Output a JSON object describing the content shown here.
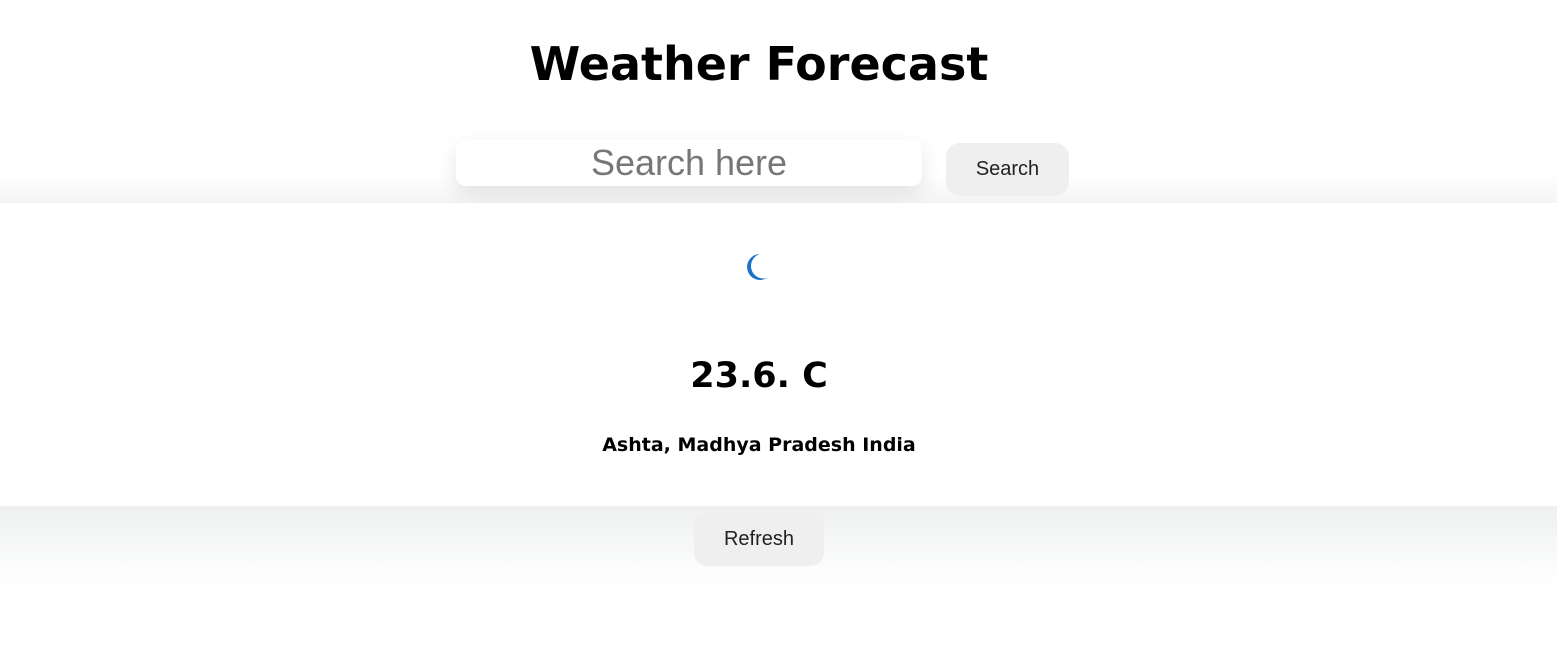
{
  "header": {
    "title": "Weather Forecast"
  },
  "search": {
    "placeholder": "Search here",
    "value": "",
    "button_label": "Search"
  },
  "weather": {
    "icon": "moon-icon",
    "icon_color": "#1a73c8",
    "temperature": "23.6. C",
    "location": "Ashta, Madhya Pradesh India"
  },
  "actions": {
    "refresh_label": "Refresh"
  }
}
